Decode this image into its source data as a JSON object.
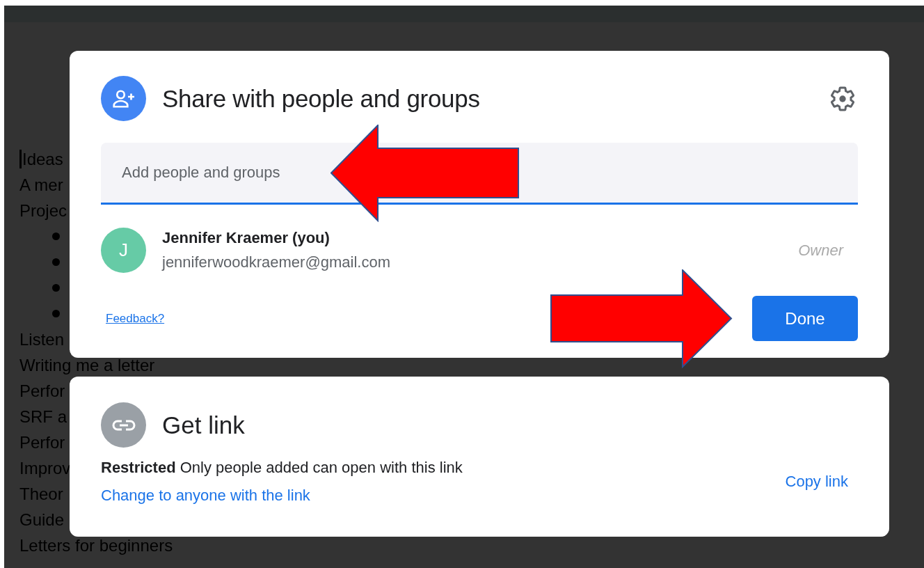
{
  "document": {
    "lines": [
      {
        "kind": "text",
        "text": "Ideas",
        "cursor": true
      },
      {
        "kind": "text",
        "text": "A mer",
        "cursor": false
      },
      {
        "kind": "text",
        "text": "Projec",
        "cursor": false
      },
      {
        "kind": "bullet"
      },
      {
        "kind": "bullet"
      },
      {
        "kind": "bullet"
      },
      {
        "kind": "bullet"
      },
      {
        "kind": "text",
        "text": "Listen",
        "cursor": false
      },
      {
        "kind": "text",
        "text": "Writing me a letter",
        "cursor": false
      },
      {
        "kind": "text",
        "text": "Perfor",
        "cursor": false
      },
      {
        "kind": "text",
        "text": "SRF a",
        "cursor": false
      },
      {
        "kind": "text",
        "text": "Perfor",
        "cursor": false
      },
      {
        "kind": "text",
        "text": "Improv",
        "cursor": false
      },
      {
        "kind": "text",
        "text": "Theor",
        "cursor": false
      },
      {
        "kind": "text",
        "text": "Guide",
        "cursor": false
      },
      {
        "kind": "text",
        "text": "Letters for beginners",
        "cursor": false
      }
    ]
  },
  "share_dialog": {
    "title": "Share with people and groups",
    "search": {
      "placeholder": "Add people and groups"
    },
    "people": [
      {
        "initial": "J",
        "name": "Jennifer Kraemer (you)",
        "email": "jenniferwoodkraemer@gmail.com",
        "role": "Owner",
        "color": "#66cba6"
      }
    ],
    "feedback_link": "Feedback?",
    "done_button": "Done"
  },
  "link_dialog": {
    "title": "Get link",
    "description": "**Restricted** Only people added can open with this link",
    "change_link": "Change to anyone with the link",
    "copy_link": "Copy link"
  },
  "annotations": [
    {
      "kind": "arrow-left"
    },
    {
      "kind": "arrow-right"
    }
  ]
}
